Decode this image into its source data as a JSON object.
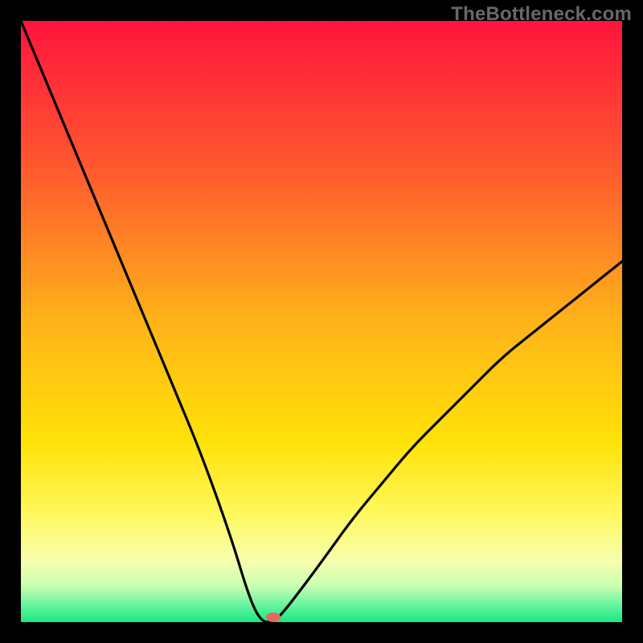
{
  "watermark": "TheBottleneck.com",
  "chart_data": {
    "type": "line",
    "title": "",
    "xlabel": "",
    "ylabel": "",
    "xlim": [
      0,
      100
    ],
    "ylim": [
      0,
      100
    ],
    "series": [
      {
        "name": "bottleneck-curve",
        "x": [
          0,
          5,
          10,
          15,
          20,
          25,
          30,
          35,
          38,
          40,
          42,
          44,
          50,
          55,
          60,
          65,
          70,
          75,
          80,
          85,
          90,
          95,
          100
        ],
        "y": [
          100,
          88,
          76,
          64,
          52,
          40,
          28,
          14,
          4,
          0,
          0,
          2,
          10,
          17,
          23,
          29,
          34,
          39,
          44,
          48,
          52,
          56,
          60
        ]
      }
    ],
    "sweet_spot_x": 42,
    "background_gradient": [
      {
        "pos": 0.0,
        "color": "#ff143d"
      },
      {
        "pos": 0.25,
        "color": "#ff5a2e"
      },
      {
        "pos": 0.5,
        "color": "#ffb319"
      },
      {
        "pos": 0.7,
        "color": "#ffe208"
      },
      {
        "pos": 0.82,
        "color": "#fff85e"
      },
      {
        "pos": 0.9,
        "color": "#f6ffaf"
      },
      {
        "pos": 0.94,
        "color": "#c9ffb0"
      },
      {
        "pos": 0.97,
        "color": "#6cf5a1"
      },
      {
        "pos": 1.0,
        "color": "#17e882"
      }
    ]
  }
}
